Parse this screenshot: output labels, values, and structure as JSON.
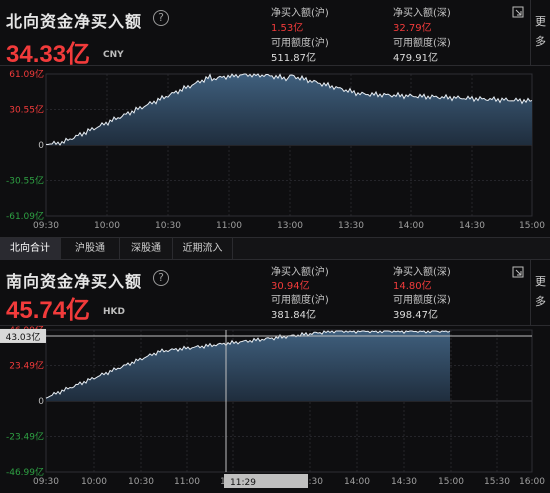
{
  "north": {
    "title": "北向资金净买入额",
    "help_glyph": "?",
    "net_value": "34.33亿",
    "currency": "CNY",
    "hu_label": "净买入额(沪)",
    "hu_value": "1.53亿",
    "shen_label": "净买入额(深)",
    "shen_value": "32.79亿",
    "hu_quota_label": "可用额度(沪)",
    "hu_quota_value": "511.87亿",
    "shen_quota_label": "可用额度(深)",
    "shen_quota_value": "479.91亿",
    "more_label": [
      "更",
      "多"
    ],
    "y_ticks": [
      "61.09亿",
      "30.55亿",
      "0",
      "-30.55亿",
      "-61.09亿"
    ],
    "x_ticks": [
      "09:30",
      "10:00",
      "10:30",
      "11:00",
      "13:00",
      "13:30",
      "14:00",
      "14:30",
      "15:00"
    ]
  },
  "tabs": [
    {
      "label": "北向合计",
      "active": true
    },
    {
      "label": "沪股通",
      "active": false
    },
    {
      "label": "深股通",
      "active": false
    },
    {
      "label": "近期流入",
      "active": false
    }
  ],
  "south": {
    "title": "南向资金净买入额",
    "help_glyph": "?",
    "net_value": "45.74亿",
    "currency": "HKD",
    "hu_label": "净买入额(沪)",
    "hu_value": "30.94亿",
    "shen_label": "净买入额(深)",
    "shen_value": "14.80亿",
    "hu_quota_label": "可用额度(沪)",
    "hu_quota_value": "381.84亿",
    "shen_quota_label": "可用额度(深)",
    "shen_quota_value": "398.47亿",
    "more_label": [
      "更",
      "多"
    ],
    "y_ticks": [
      "46.99亿",
      "23.49亿",
      "0",
      "-23.49亿",
      "-46.99亿"
    ],
    "x_ticks": [
      "09:30",
      "10:00",
      "10:30",
      "11:00",
      "11:30",
      "13:30",
      "14:00",
      "14:30",
      "15:00",
      "15:30",
      "16:00"
    ],
    "crosshair_value": "43.03亿",
    "crosshair_time": "11:29"
  },
  "colors": {
    "accent_red": "#f23b3b",
    "area_top": "#3f5f7d",
    "area_bottom": "#1f2d3d",
    "line": "#e8eef4"
  }
}
